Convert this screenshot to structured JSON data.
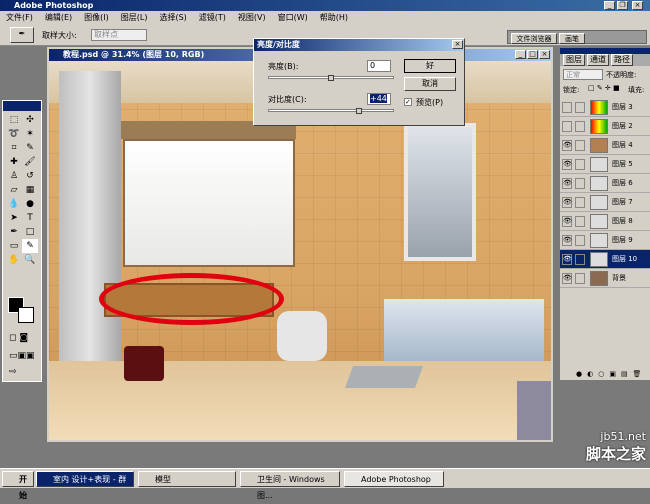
{
  "app": {
    "title": "Adobe Photoshop"
  },
  "menu": [
    "文件(F)",
    "编辑(E)",
    "图像(I)",
    "图层(L)",
    "选择(S)",
    "滤镜(T)",
    "视图(V)",
    "窗口(W)",
    "帮助(H)"
  ],
  "options": {
    "sample_label": "取样大小:",
    "sample_value": "取样点"
  },
  "palette_well": {
    "tabs": [
      "文件浏览器",
      "画笔"
    ]
  },
  "document": {
    "title": "教程.psd @ 31.4% (图层 10, RGB)"
  },
  "dialog": {
    "title": "亮度/对比度",
    "brightness_label": "亮度(B):",
    "brightness_value": "0",
    "brightness_pos": 0.5,
    "contrast_label": "对比度(C):",
    "contrast_value": "+44",
    "contrast_pos": 0.72,
    "ok": "好",
    "cancel": "取消",
    "preview_label": "预览(P)",
    "preview_checked": true
  },
  "layers_panel": {
    "tabs": [
      "图层",
      "通道",
      "路径"
    ],
    "blend_mode": "正常",
    "opacity_label": "不透明度:",
    "lock_label": "锁定:",
    "fill_label": "填充:",
    "layers": [
      {
        "name": "图层 3",
        "visible": false
      },
      {
        "name": "图层 2",
        "visible": false
      },
      {
        "name": "图层 4",
        "visible": true
      },
      {
        "name": "图层 5",
        "visible": true
      },
      {
        "name": "图层 6",
        "visible": true
      },
      {
        "name": "图层 7",
        "visible": true
      },
      {
        "name": "图层 8",
        "visible": true
      },
      {
        "name": "图层 9",
        "visible": true
      },
      {
        "name": "图层 10",
        "visible": true,
        "selected": true
      },
      {
        "name": "背景",
        "visible": true
      }
    ]
  },
  "taskbar": {
    "start": "开始",
    "tasks": [
      "室内 设计+表现 - 群",
      "模型",
      "卫生间 - Windows 图...",
      "Adobe Photoshop"
    ]
  },
  "watermark": {
    "site": "jb51.net",
    "name": "脚本之家"
  }
}
